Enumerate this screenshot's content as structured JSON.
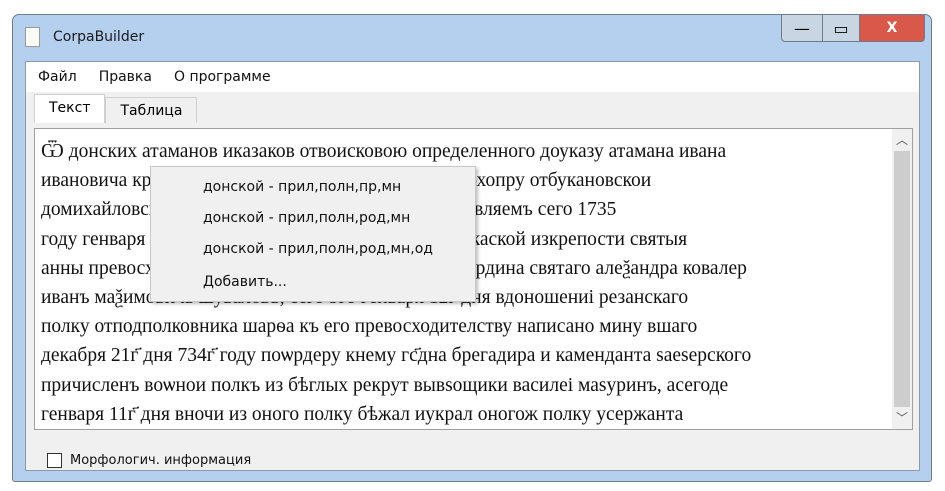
{
  "window": {
    "title": "CorpaBuilder",
    "minimize": "—",
    "maximize": "▭",
    "close": "X"
  },
  "menu": [
    "Файл",
    "Правка",
    "О программе"
  ],
  "tabs": [
    "Текст",
    "Таблица"
  ],
  "text_lines": [
    "Ѿ донских атаманов иказаков отвоисковою определенного доуказу атамана ивана",
    "ивановича краснощекова и всего войска донскаго похопру отбукановскои",
    "домихайловскои станицы атаманомъ и казакамъ обявляемъ сего 1735",
    "году генваря 9го дня пишет к войску донскому вчеркаской изкрепости святыя",
    "анны превосходителныи господин генерал майор иордина святаго алеѯандра ковалер",
    "иванъ маѯимовичь шуваловъ, сего 9го генваря 12г҃ дня вдоношениі резанскаго",
    "полку отподполковника шарѳа къ его превосходителству написано мину вшаго",
    "декабря 21г҃ дня 734г҃ году поѡрдеру кнему гс҃дна брегадира и каменданта ѕаеѕерского",
    "причисленъ воѡнои полкъ из бѣглых рекрут вывѕощики василеі маѕуринъ, асегоде",
    "генваря 11г҃ дня вночи из оного полку бѣжал иукрал оногож полку усержанта"
  ],
  "context_menu": [
    "донской - прил,полн,пр,мн",
    "донской - прил,полн,род,мн",
    "донской - прил,полн,род,мн,од",
    "Добавить..."
  ],
  "checkbox_label": "Морфологич. информация"
}
